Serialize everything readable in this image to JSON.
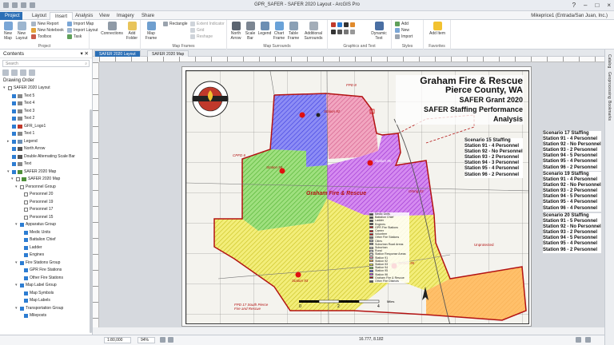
{
  "window": {
    "title": "GPR_SAFER - SAFER 2020 Layout - ArcGIS Pro"
  },
  "ribbon_tabs": [
    "Project",
    "Layout",
    "Insert",
    "Analysis",
    "View",
    "Imagery",
    "Share"
  ],
  "active_tab": "Insert",
  "user": "Mikeprice1 (Entrada/San Juan, Inc.)",
  "ribbon": {
    "project": {
      "label": "Project",
      "new_map": "New Map",
      "new_layout": "New Layout",
      "new_report": "New Report",
      "new_notebook": "New Notebook",
      "toolbox": "Toolbox",
      "import_map": "Import Map",
      "import_layout": "Import Layout",
      "task": "Task",
      "connections": "Connections",
      "add_folder": "Add Folder"
    },
    "map_frames": {
      "label": "Map Frames",
      "map_frame": "Map Frame",
      "rectangle": "Rectangle",
      "extent_indicator": "Extent Indicator",
      "grid": "Grid",
      "reshape": "Reshape"
    },
    "map_surrounds": {
      "label": "Map Surrounds",
      "north_arrow": "North Arrow",
      "scale_bar": "Scale Bar",
      "legend": "Legend",
      "chart_frame": "Chart Frame",
      "table_frame": "Table Frame",
      "additional_surrounds": "Additional Surrounds"
    },
    "graphics": {
      "label": "Graphics and Text",
      "dynamic_text": "Dynamic Text"
    },
    "styles": {
      "label": "Styles",
      "add": "Add",
      "new": "New",
      "import": "Import"
    },
    "favorites": {
      "label": "Favorites",
      "add_item": "Add Item"
    }
  },
  "contents": {
    "title": "Contents",
    "search_placeholder": "Search",
    "drawing_order": "Drawing Order",
    "items": [
      {
        "label": "SAFER 2020 Layout",
        "indent": 0,
        "expander": "▾",
        "checked": false,
        "swatch": ""
      },
      {
        "label": "Text 5",
        "indent": 1,
        "expander": "",
        "checked": true,
        "swatch": "#888888"
      },
      {
        "label": "Text 4",
        "indent": 1,
        "expander": "",
        "checked": true,
        "swatch": "#888888"
      },
      {
        "label": "Text 3",
        "indent": 1,
        "expander": "",
        "checked": true,
        "swatch": "#888888"
      },
      {
        "label": "Text 2",
        "indent": 1,
        "expander": "",
        "checked": true,
        "swatch": "#888888"
      },
      {
        "label": "GFR_Logo1",
        "indent": 1,
        "expander": "",
        "checked": true,
        "swatch": "#c0392b"
      },
      {
        "label": "Text 1",
        "indent": 1,
        "expander": "",
        "checked": true,
        "swatch": "#888888"
      },
      {
        "label": "Legend",
        "indent": 1,
        "expander": "▸",
        "checked": true,
        "swatch": "#6d8fb3"
      },
      {
        "label": "North Arrow",
        "indent": 1,
        "expander": "",
        "checked": true,
        "swatch": "#555555"
      },
      {
        "label": "Double Alternating Scale Bar",
        "indent": 1,
        "expander": "",
        "checked": true,
        "swatch": "#555555"
      },
      {
        "label": "Text",
        "indent": 1,
        "expander": "",
        "checked": true,
        "swatch": "#888888"
      },
      {
        "label": "SAFER 2020 Map",
        "indent": 1,
        "expander": "▾",
        "checked": true,
        "swatch": "#4f8f3a"
      },
      {
        "label": "SAFER 2020 Map",
        "indent": 2,
        "expander": "▾",
        "checked": false,
        "swatch": "#4f8f3a"
      },
      {
        "label": "Personnel Group",
        "indent": 3,
        "expander": "▾",
        "checked": false,
        "swatch": ""
      },
      {
        "label": "Personnel 20",
        "indent": 4,
        "expander": "",
        "checked": false,
        "swatch": ""
      },
      {
        "label": "Personnel 19",
        "indent": 4,
        "expander": "",
        "checked": false,
        "swatch": ""
      },
      {
        "label": "Personnel 17",
        "indent": 4,
        "expander": "",
        "checked": false,
        "swatch": ""
      },
      {
        "label": "Personnel 15",
        "indent": 4,
        "expander": "",
        "checked": false,
        "swatch": ""
      },
      {
        "label": "Apparatus Group",
        "indent": 3,
        "expander": "▾",
        "checked": true,
        "swatch": ""
      },
      {
        "label": "Medic Units",
        "indent": 4,
        "expander": "",
        "checked": true,
        "swatch": ""
      },
      {
        "label": "Battalion Chief",
        "indent": 4,
        "expander": "",
        "checked": true,
        "swatch": ""
      },
      {
        "label": "Ladder",
        "indent": 4,
        "expander": "",
        "checked": true,
        "swatch": ""
      },
      {
        "label": "Engines",
        "indent": 4,
        "expander": "",
        "checked": true,
        "swatch": ""
      },
      {
        "label": "Fire Stations Group",
        "indent": 3,
        "expander": "▾",
        "checked": true,
        "swatch": ""
      },
      {
        "label": "GPR Fire Stations",
        "indent": 4,
        "expander": "",
        "checked": true,
        "swatch": ""
      },
      {
        "label": "Other Fire Stations",
        "indent": 4,
        "expander": "",
        "checked": true,
        "swatch": ""
      },
      {
        "label": "Map Label Group",
        "indent": 3,
        "expander": "▾",
        "checked": true,
        "swatch": ""
      },
      {
        "label": "Map Symbols",
        "indent": 4,
        "expander": "",
        "checked": true,
        "swatch": ""
      },
      {
        "label": "Map Labels",
        "indent": 4,
        "expander": "",
        "checked": true,
        "swatch": ""
      },
      {
        "label": "Transportation Group",
        "indent": 3,
        "expander": "▾",
        "checked": true,
        "swatch": ""
      },
      {
        "label": "Mileposts",
        "indent": 4,
        "expander": "",
        "checked": true,
        "swatch": ""
      }
    ]
  },
  "doc_tabs": [
    "SAFER 2020 Layout",
    "SAFER 2020 Map"
  ],
  "layout": {
    "title": [
      "Graham Fire & Rescue",
      "Pierce County, WA",
      "SAFER Grant 2020",
      "SAFER Staffing Performance Analysis"
    ],
    "scenario15": [
      "Scenario 15 Staffing",
      "Station 91 - 4 Personnel",
      "Station 92 - No Personnel",
      "Station 93 - 2 Personnel",
      "Station 94 - 3 Personnel",
      "Station 95 - 4 Personnel",
      "Station 96 - 2 Personnel"
    ],
    "scenario17": [
      "Scenario 17 Staffing",
      "Station 91 - 4 Personnel",
      "Station 92 - No Personnel",
      "Station 93 - 2 Personnel",
      "Station 94 - 5 Personnel",
      "Station 95 - 4 Personnel",
      "Station 96 - 2 Personnel"
    ],
    "scenario19": [
      "Scenario 19 Staffing",
      "Station 91 - 4 Personnel",
      "Station 92 - No Personnel",
      "Station 93 - 2 Personnel",
      "Station 94 - 5 Personnel",
      "Station 95 - 4 Personnel",
      "Station 96 - 4 Personnel"
    ],
    "scenario20": [
      "Scenario 20 Staffing",
      "Station 91 - 5 Personnel",
      "Station 92 - No Personnel",
      "Station 93 - 2 Personnel",
      "Station 94 - 5 Personnel",
      "Station 95 - 4 Personnel",
      "Station 96 - 2 Personnel"
    ],
    "map_labels": {
      "district": "Graham Fire & Rescue",
      "fpd17": "FPD 17 South Pierce Fire and Rescue",
      "st94": "Station 94",
      "st96": "Station 96",
      "st93": "Station 93",
      "st95": "Station 95",
      "st92": "Station 92",
      "unprotected": "Unprotected",
      "orting": "Orting 43",
      "fpd8": "FPD 8",
      "cpfd": "CPFD 6"
    },
    "legend": [
      {
        "label": "Medic Units",
        "color": "#444444"
      },
      {
        "label": "Battalion Chief",
        "color": "#444444"
      },
      {
        "label": "Ladder",
        "color": "#444444"
      },
      {
        "label": "Engines",
        "color": "#444444"
      },
      {
        "label": "GPR Fire Stations",
        "color": "#d01010"
      },
      {
        "label": "Career",
        "color": "#d01010"
      },
      {
        "label": "Volunteer",
        "color": "#d01010"
      },
      {
        "label": "Other Fire Stations",
        "color": "#777777"
      },
      {
        "label": "Cities",
        "color": "#bbbbbb"
      },
      {
        "label": "Suburban Road Areas",
        "color": "#999999"
      },
      {
        "label": "Suburban",
        "color": "#cccccc"
      },
      {
        "label": "Rural",
        "color": "#eeeeee"
      },
      {
        "label": "Station Response Areas",
        "color": "#ffffff"
      },
      {
        "label": "Station 91",
        "color": "#ff8fa6"
      },
      {
        "label": "Station 92",
        "color": "#ffb34d"
      },
      {
        "label": "Station 93",
        "color": "#f0ea3a"
      },
      {
        "label": "Station 94",
        "color": "#6ed34a"
      },
      {
        "label": "Station 95",
        "color": "#5a5af5"
      },
      {
        "label": "Station 96",
        "color": "#c74ee8"
      },
      {
        "label": "Graham Fire & Rescue",
        "color": "#b31212"
      },
      {
        "label": "Other Fire Districts",
        "color": "#555555"
      }
    ],
    "scale_labels": [
      "0",
      "2",
      "4"
    ],
    "scale_unit": "Miles"
  },
  "status": {
    "scale": "1:80,000",
    "zoom": "94%",
    "coords": "16.777, 8.182"
  },
  "right_panels": [
    "Catalog",
    "Geoprocessing",
    "Bookmarks"
  ],
  "colors": {
    "project_tab": "#2b6fb6",
    "district_border": "#b31212",
    "station_red": "#e01010"
  }
}
